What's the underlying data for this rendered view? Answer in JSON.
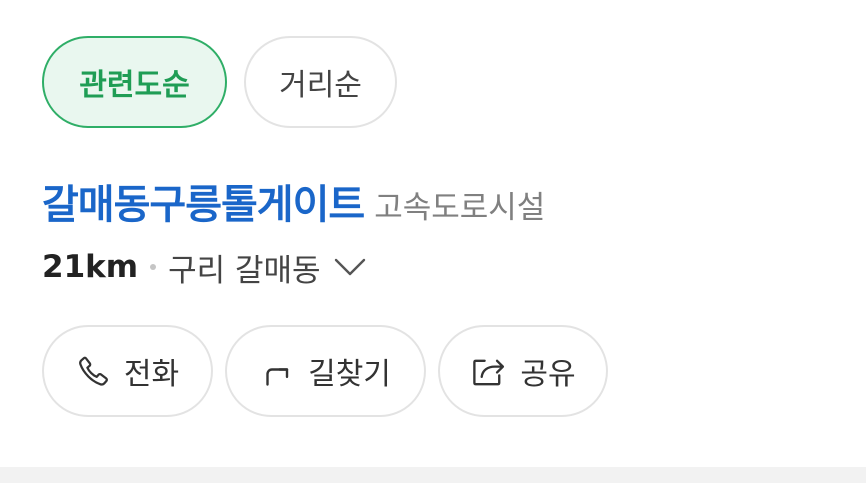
{
  "sort_tabs": [
    {
      "label": "관련도순",
      "active": true
    },
    {
      "label": "거리순",
      "active": false
    }
  ],
  "place": {
    "name": "갈매동구릉톨게이트",
    "category": "고속도로시설",
    "distance": "21km",
    "address": "구리 갈매동"
  },
  "actions": {
    "call_label": "전화",
    "route_label": "길찾기",
    "share_label": "공유"
  },
  "icons": {
    "call": "phone-icon",
    "route": "turn-arrow-icon",
    "share": "share-icon",
    "expand": "chevron-down-icon"
  },
  "colors": {
    "accent_green": "#1f9d55",
    "active_chip_bg": "#e9f7ef",
    "title_blue": "#1a66c9"
  }
}
